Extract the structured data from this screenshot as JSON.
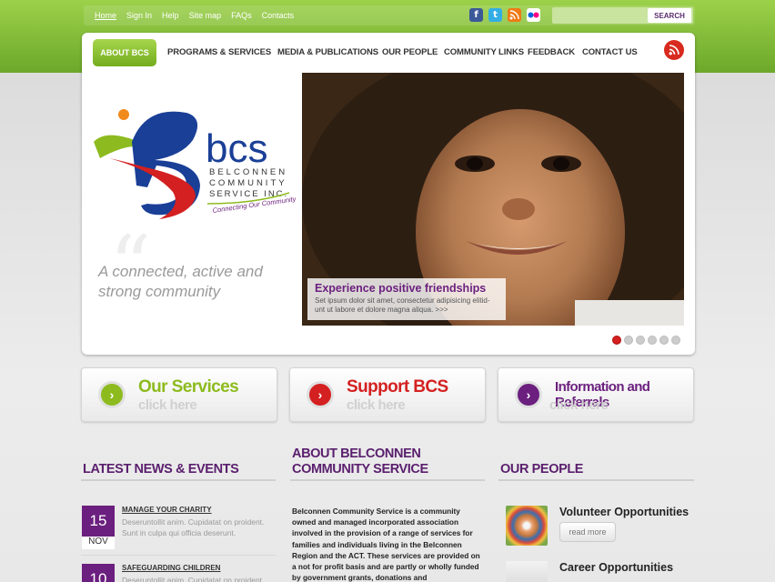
{
  "topbar": {
    "links": [
      "Home",
      "Sign In",
      "Help",
      "Site map",
      "FAQs",
      "Contacts"
    ],
    "social_icons": [
      "facebook-icon",
      "twitter-icon",
      "rss-icon",
      "flickr-icon"
    ],
    "search_placeholder": "",
    "search_button": "SEARCH"
  },
  "nav": {
    "items": [
      "ABOUT BCS",
      "PROGRAMS & SERVICES",
      "MEDIA & PUBLICATIONS",
      "OUR PEOPLE",
      "COMMUNITY LINKS",
      "FEEDBACK",
      "CONTACT US"
    ]
  },
  "logo": {
    "abbr": "bcs",
    "line1": "BELCONNEN",
    "line2": "COMMUNITY",
    "line3": "SERVICE INC.",
    "slogan": "Connecting Our Community"
  },
  "hero": {
    "tagline_line1": "A connected, active and",
    "tagline_line2": "strong community",
    "caption_title": "Experience positive friendships",
    "caption_text": "Set ipsum dolor sit amet, consectetur adipisicing elitid-unt ut labore et dolore magna aliqua. >>>",
    "slide_count": 6,
    "active_slide": 1
  },
  "promos": [
    {
      "title": "Our Services",
      "sub": "click here",
      "color": "#8dbb1f"
    },
    {
      "title": "Support BCS",
      "sub": "click here",
      "color": "#d42020"
    },
    {
      "title": "Information and Referrals",
      "sub": "click here",
      "color": "#6b1f7e"
    }
  ],
  "news": {
    "heading": "LATEST NEWS & EVENTS",
    "items": [
      {
        "day": "15",
        "month": "NOV",
        "title": "MANAGE YOUR CHARITY",
        "desc": "Deseruntollit anim. Cupidatat on proident. Sunt in culpa qui officia deserunt."
      },
      {
        "day": "10",
        "month": "",
        "title": "SAFEGUARDING CHILDREN",
        "desc": "Deseruntollit anim. Cupidatat on proident."
      }
    ]
  },
  "about": {
    "heading_line1": "ABOUT BELCONNEN",
    "heading_line2": "COMMUNITY SERVICE",
    "text": "Belconnen Community Service is a community owned and managed incorporated association involved in the provision of a range of services for families and individuals living in the Belconnen Region and the ACT. These services are provided on a not for profit basis and are partly or wholly funded by government grants, donations and"
  },
  "people": {
    "heading": "OUR PEOPLE",
    "items": [
      {
        "title": "Volunteer Opportunities",
        "button": "read more"
      },
      {
        "title": "Career Opportunities",
        "button": ""
      }
    ]
  },
  "colors": {
    "green": "#8dbb1f",
    "purple": "#6b1f7e",
    "red": "#d42020"
  }
}
